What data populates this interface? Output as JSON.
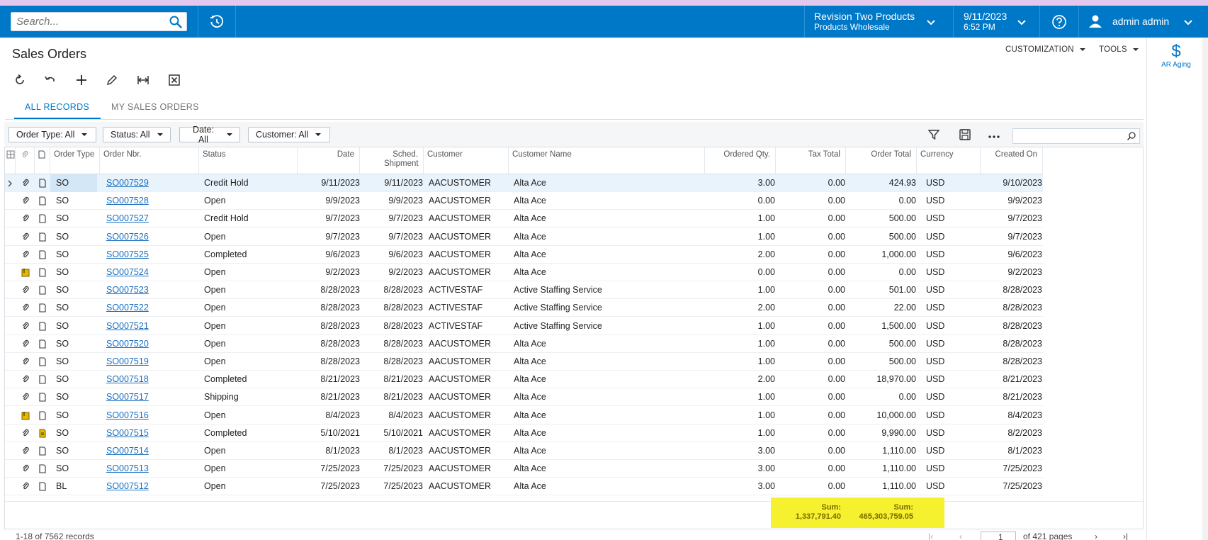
{
  "topbar": {
    "search_placeholder": "Search...",
    "company_line1": "Revision Two Products",
    "company_line2": "Products Wholesale",
    "date": "9/11/2023",
    "time": "6:52 PM",
    "user": "admin admin",
    "bar_color": "#0078c8"
  },
  "page": {
    "title": "Sales Orders",
    "customization_label": "CUSTOMIZATION",
    "tools_label": "TOOLS"
  },
  "toolbar_icons": [
    "refresh-icon",
    "undo-icon",
    "add-icon",
    "edit-icon",
    "fit-columns-icon",
    "export-excel-icon"
  ],
  "tabs": [
    {
      "label": "ALL RECORDS",
      "active": true
    },
    {
      "label": "MY SALES ORDERS",
      "active": false
    }
  ],
  "filters": [
    {
      "label": "Order Type: All"
    },
    {
      "label": "Status: All"
    },
    {
      "label": "Date: All"
    },
    {
      "label": "Customer: All"
    }
  ],
  "grid": {
    "columns": {
      "order_type": "Order Type",
      "order_nbr": "Order Nbr.",
      "status": "Status",
      "date": "Date",
      "sched_shipment": "Sched. Shipment",
      "customer": "Customer",
      "customer_name": "Customer Name",
      "ordered_qty": "Ordered Qty.",
      "tax_total": "Tax Total",
      "order_total": "Order Total",
      "currency": "Currency",
      "created_on": "Created On"
    },
    "rows": [
      {
        "type": "SO",
        "nbr": "SO007529",
        "status": "Credit Hold",
        "date": "9/11/2023",
        "sched": "9/11/2023",
        "cust": "AACUSTOMER",
        "name": "Alta Ace",
        "qty": "3.00",
        "tax": "0.00",
        "total": "424.93",
        "cur": "USD",
        "created": "9/10/2023",
        "files": "none",
        "notes": "empty"
      },
      {
        "type": "SO",
        "nbr": "SO007528",
        "status": "Open",
        "date": "9/9/2023",
        "sched": "9/9/2023",
        "cust": "AACUSTOMER",
        "name": "Alta Ace",
        "qty": "0.00",
        "tax": "0.00",
        "total": "0.00",
        "cur": "USD",
        "created": "9/9/2023",
        "files": "none",
        "notes": "empty"
      },
      {
        "type": "SO",
        "nbr": "SO007527",
        "status": "Credit Hold",
        "date": "9/7/2023",
        "sched": "9/7/2023",
        "cust": "AACUSTOMER",
        "name": "Alta Ace",
        "qty": "1.00",
        "tax": "0.00",
        "total": "500.00",
        "cur": "USD",
        "created": "9/7/2023",
        "files": "none",
        "notes": "empty"
      },
      {
        "type": "SO",
        "nbr": "SO007526",
        "status": "Open",
        "date": "9/7/2023",
        "sched": "9/7/2023",
        "cust": "AACUSTOMER",
        "name": "Alta Ace",
        "qty": "1.00",
        "tax": "0.00",
        "total": "500.00",
        "cur": "USD",
        "created": "9/7/2023",
        "files": "none",
        "notes": "empty"
      },
      {
        "type": "SO",
        "nbr": "SO007525",
        "status": "Completed",
        "date": "9/6/2023",
        "sched": "9/6/2023",
        "cust": "AACUSTOMER",
        "name": "Alta Ace",
        "qty": "2.00",
        "tax": "0.00",
        "total": "1,000.00",
        "cur": "USD",
        "created": "9/6/2023",
        "files": "none",
        "notes": "empty"
      },
      {
        "type": "SO",
        "nbr": "SO007524",
        "status": "Open",
        "date": "9/2/2023",
        "sched": "9/2/2023",
        "cust": "AACUSTOMER",
        "name": "Alta Ace",
        "qty": "0.00",
        "tax": "0.00",
        "total": "0.00",
        "cur": "USD",
        "created": "9/2/2023",
        "files": "has",
        "notes": "empty"
      },
      {
        "type": "SO",
        "nbr": "SO007523",
        "status": "Open",
        "date": "8/28/2023",
        "sched": "8/28/2023",
        "cust": "ACTIVESTAF",
        "name": "Active Staffing Service",
        "qty": "1.00",
        "tax": "0.00",
        "total": "501.00",
        "cur": "USD",
        "created": "8/28/2023",
        "files": "none",
        "notes": "empty"
      },
      {
        "type": "SO",
        "nbr": "SO007522",
        "status": "Open",
        "date": "8/28/2023",
        "sched": "8/28/2023",
        "cust": "ACTIVESTAF",
        "name": "Active Staffing Service",
        "qty": "2.00",
        "tax": "0.00",
        "total": "22.00",
        "cur": "USD",
        "created": "8/28/2023",
        "files": "none",
        "notes": "empty"
      },
      {
        "type": "SO",
        "nbr": "SO007521",
        "status": "Open",
        "date": "8/28/2023",
        "sched": "8/28/2023",
        "cust": "ACTIVESTAF",
        "name": "Active Staffing Service",
        "qty": "1.00",
        "tax": "0.00",
        "total": "1,500.00",
        "cur": "USD",
        "created": "8/28/2023",
        "files": "none",
        "notes": "empty"
      },
      {
        "type": "SO",
        "nbr": "SO007520",
        "status": "Open",
        "date": "8/28/2023",
        "sched": "8/28/2023",
        "cust": "AACUSTOMER",
        "name": "Alta Ace",
        "qty": "1.00",
        "tax": "0.00",
        "total": "500.00",
        "cur": "USD",
        "created": "8/28/2023",
        "files": "none",
        "notes": "empty"
      },
      {
        "type": "SO",
        "nbr": "SO007519",
        "status": "Open",
        "date": "8/28/2023",
        "sched": "8/28/2023",
        "cust": "AACUSTOMER",
        "name": "Alta Ace",
        "qty": "1.00",
        "tax": "0.00",
        "total": "500.00",
        "cur": "USD",
        "created": "8/28/2023",
        "files": "none",
        "notes": "empty"
      },
      {
        "type": "SO",
        "nbr": "SO007518",
        "status": "Completed",
        "date": "8/21/2023",
        "sched": "8/21/2023",
        "cust": "AACUSTOMER",
        "name": "Alta Ace",
        "qty": "2.00",
        "tax": "0.00",
        "total": "18,970.00",
        "cur": "USD",
        "created": "8/21/2023",
        "files": "none",
        "notes": "empty"
      },
      {
        "type": "SO",
        "nbr": "SO007517",
        "status": "Shipping",
        "date": "8/21/2023",
        "sched": "8/21/2023",
        "cust": "AACUSTOMER",
        "name": "Alta Ace",
        "qty": "1.00",
        "tax": "0.00",
        "total": "0.00",
        "cur": "USD",
        "created": "8/21/2023",
        "files": "none",
        "notes": "empty"
      },
      {
        "type": "SO",
        "nbr": "SO007516",
        "status": "Open",
        "date": "8/4/2023",
        "sched": "8/4/2023",
        "cust": "AACUSTOMER",
        "name": "Alta Ace",
        "qty": "1.00",
        "tax": "0.00",
        "total": "10,000.00",
        "cur": "USD",
        "created": "8/4/2023",
        "files": "has",
        "notes": "empty"
      },
      {
        "type": "SO",
        "nbr": "SO007515",
        "status": "Completed",
        "date": "5/10/2021",
        "sched": "5/10/2021",
        "cust": "AACUSTOMER",
        "name": "Alta Ace",
        "qty": "1.00",
        "tax": "0.00",
        "total": "9,990.00",
        "cur": "USD",
        "created": "8/2/2023",
        "files": "none",
        "notes": "has"
      },
      {
        "type": "SO",
        "nbr": "SO007514",
        "status": "Open",
        "date": "8/1/2023",
        "sched": "8/1/2023",
        "cust": "AACUSTOMER",
        "name": "Alta Ace",
        "qty": "3.00",
        "tax": "0.00",
        "total": "1,110.00",
        "cur": "USD",
        "created": "8/1/2023",
        "files": "none",
        "notes": "empty"
      },
      {
        "type": "SO",
        "nbr": "SO007513",
        "status": "Open",
        "date": "7/25/2023",
        "sched": "7/25/2023",
        "cust": "AACUSTOMER",
        "name": "Alta Ace",
        "qty": "3.00",
        "tax": "0.00",
        "total": "1,110.00",
        "cur": "USD",
        "created": "7/25/2023",
        "files": "none",
        "notes": "empty"
      },
      {
        "type": "BL",
        "nbr": "SO007512",
        "status": "Open",
        "date": "7/25/2023",
        "sched": "7/25/2023",
        "cust": "AACUSTOMER",
        "name": "Alta Ace",
        "qty": "3.00",
        "tax": "0.00",
        "total": "1,110.00",
        "cur": "USD",
        "created": "7/25/2023",
        "files": "none",
        "notes": "empty"
      }
    ],
    "sums": {
      "label": "Sum:",
      "tax_total": "1,337,791.40",
      "order_total": "465,303,759.05",
      "highlight_color": "#f5f12e"
    }
  },
  "pager": {
    "records_text": "1-18 of 7562 records",
    "page_value": "1",
    "of_pages_text": "of 421 pages"
  },
  "right_panel": {
    "ar_aging_label": "AR Aging",
    "ar_aging_symbol": "$"
  }
}
